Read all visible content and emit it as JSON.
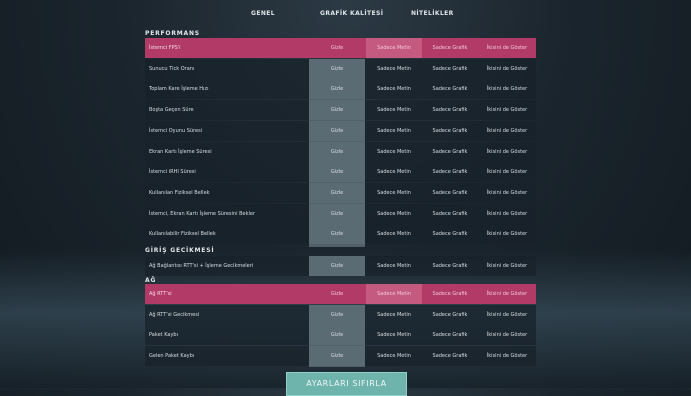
{
  "tabs": [
    {
      "label": "GENEL"
    },
    {
      "label": "GRAFİK KALİTESİ"
    },
    {
      "label": "NİTELİKLER"
    }
  ],
  "options": [
    "Gizle",
    "Sadece Metin",
    "Sadece Grafik",
    "İkisini de Göster"
  ],
  "sections": {
    "performance": {
      "title": "PERFORMANS",
      "rows": [
        {
          "label": "İstemci FPS'i"
        },
        {
          "label": "Sunucu Tick Oranı"
        },
        {
          "label": "Toplam Kare İşleme Hızı"
        },
        {
          "label": "Boşta Geçen Süre"
        },
        {
          "label": "İstemci Oyunu Süresi"
        },
        {
          "label": "Ekran Kartı İşleme Süresi"
        },
        {
          "label": "İstemci iRHI Süresi"
        },
        {
          "label": "Kullanılan Fiziksel Bellek"
        },
        {
          "label": "İstemci, Ekran Kartı İşleme Süresini Bekler"
        },
        {
          "label": "Kullanılabilir Fiziksel Bellek"
        }
      ]
    },
    "latency": {
      "title": "GİRİŞ GECİKMESİ",
      "rows": [
        {
          "label": "Ağ Bağlantısı RTT'si + İşleme Gecikmeleri"
        }
      ]
    },
    "network": {
      "title": "AĞ",
      "rows": [
        {
          "label": "Ağ RTT'si"
        },
        {
          "label": "Ağ RTT'si Gecikmesi"
        },
        {
          "label": "Paket Kaybı"
        },
        {
          "label": "Gelen Paket Kaybı"
        }
      ]
    }
  },
  "reset_button": {
    "label": "AYARLARI SIFIRLA"
  },
  "colors": {
    "highlight": "#b23a66",
    "selected_column": "#5a6b74",
    "button": "#6fb3ad"
  }
}
